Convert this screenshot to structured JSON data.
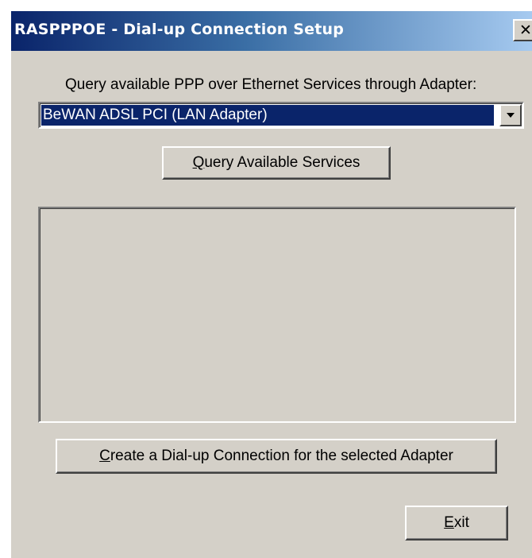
{
  "window": {
    "title": "RASPPPOE - Dial-up Connection Setup",
    "close_glyph": "✕"
  },
  "adapter": {
    "prompt": "Query available PPP over Ethernet Services through Adapter:",
    "selected": "BeWAN ADSL PCI (LAN Adapter)"
  },
  "buttons": {
    "query": {
      "accel": "Q",
      "rest": "uery Available Services"
    },
    "create": {
      "accel": "C",
      "rest": "reate a Dial-up Connection for the selected Adapter"
    },
    "exit": {
      "accel": "E",
      "rest": "xit"
    }
  },
  "services_list": {
    "items": []
  },
  "colors": {
    "face": "#d4d0c8",
    "title_start": "#0a246a",
    "title_end": "#a6caf0",
    "selection": "#0a246a"
  }
}
